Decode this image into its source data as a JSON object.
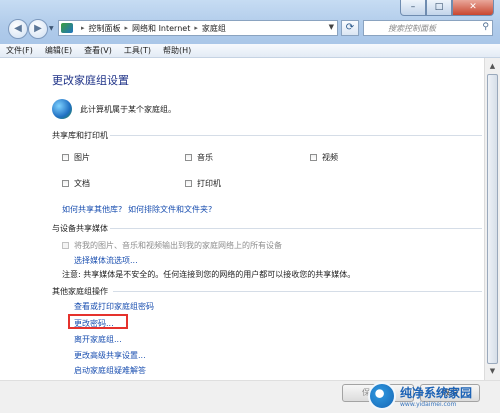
{
  "window": {
    "minimize": "–",
    "maximize": "□",
    "close": "✕"
  },
  "nav": {
    "back_icon": "arrow-left-icon",
    "forward_icon": "arrow-right-icon",
    "recent_icon": "chevron-down-icon",
    "breadcrumbs": [
      "控制面板",
      "网络和 Internet",
      "家庭组"
    ],
    "search_placeholder": "搜索控制面板"
  },
  "menu": [
    "文件(F)",
    "编辑(E)",
    "查看(V)",
    "工具(T)",
    "帮助(H)"
  ],
  "page": {
    "title": "更改家庭组设置",
    "membership": "此计算机属于某个家庭组。"
  },
  "libraries": {
    "heading": "共享库和打印机",
    "items": [
      {
        "label": "图片",
        "checked": false
      },
      {
        "label": "音乐",
        "checked": false
      },
      {
        "label": "视频",
        "checked": false
      },
      {
        "label": "文档",
        "checked": false
      },
      {
        "label": "打印机",
        "checked": false
      }
    ],
    "link_share_libs": "如何共享其他库?",
    "link_exclude": "如何排除文件和文件夹?"
  },
  "media": {
    "heading": "与设备共享媒体",
    "stream_option": "将我的图片、音乐和视频输出到我的家庭网络上的所有设备",
    "choose_options": "选择媒体流选项...",
    "note": "注意: 共享媒体是不安全的。任何连接到您的网络的用户都可以接收您的共享媒体。"
  },
  "other_actions": {
    "heading": "其他家庭组操作",
    "links": [
      "查看或打印家庭组密码",
      "更改密码...",
      "离开家庭组...",
      "更改高级共享设置...",
      "启动家庭组疑难解答"
    ]
  },
  "footer": {
    "save_label": "保存修改",
    "cancel_label": "取消"
  },
  "watermark": {
    "text": "纯净系统家园",
    "url": "www.yidaimei.com"
  },
  "colors": {
    "title": "#1e3287",
    "link": "#1a4fb0",
    "highlight_box": "#e5322d"
  }
}
